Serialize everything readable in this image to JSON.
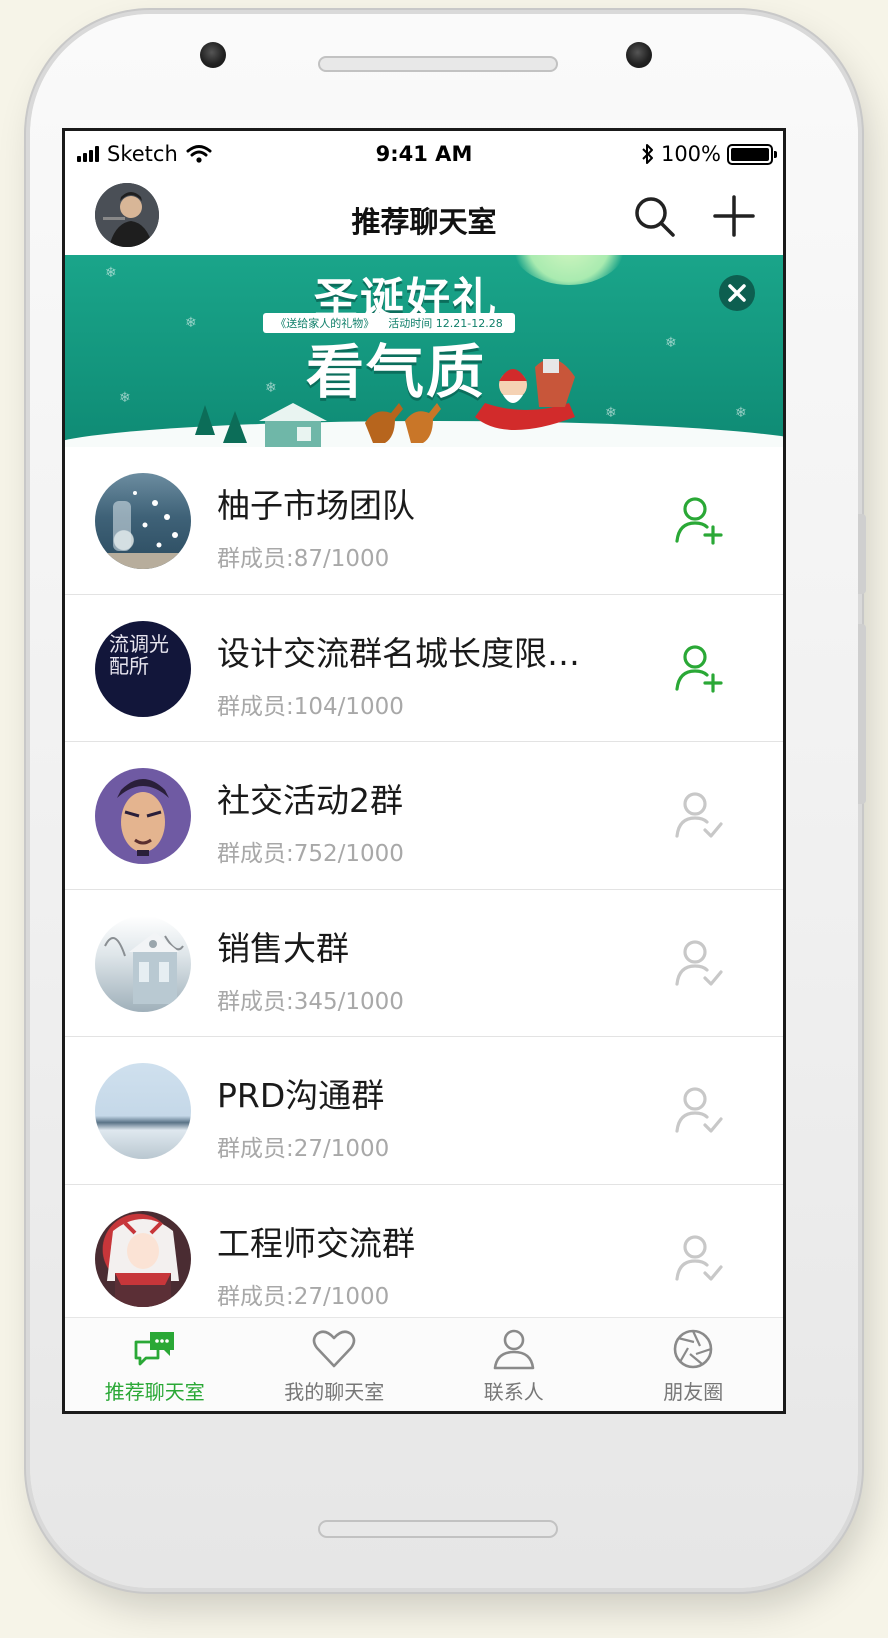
{
  "status_bar": {
    "carrier": "Sketch",
    "time": "9:41 AM",
    "battery": "100%",
    "battery_level": 1.0
  },
  "nav": {
    "title": "推荐聊天室",
    "avatar_icon": "user-avatar",
    "search_icon": "search-icon",
    "add_icon": "plus-icon"
  },
  "banner": {
    "headline": "圣诞好礼",
    "ribbon_left": "《送给家人的礼物》",
    "ribbon_right": "活动时间 12.21-12.28",
    "subline": "看气质",
    "close_icon": "close-icon"
  },
  "rooms": [
    {
      "name": "柚子市场团队",
      "members": "群成员:87/1000",
      "joined": false
    },
    {
      "name": "设计交流群名城长度限…",
      "members": "群成员:104/1000",
      "joined": false,
      "avatar_text": "流调光配所"
    },
    {
      "name": "社交活动2群",
      "members": "群成员:752/1000",
      "joined": true
    },
    {
      "name": "销售大群",
      "members": "群成员:345/1000",
      "joined": true
    },
    {
      "name": "PRD沟通群",
      "members": "群成员:27/1000",
      "joined": true
    },
    {
      "name": "工程师交流群",
      "members": "群成员:27/1000",
      "joined": true
    }
  ],
  "tabs": [
    {
      "label": "推荐聊天室",
      "icon": "chat-bubbles-icon",
      "active": true
    },
    {
      "label": "我的聊天室",
      "icon": "heart-icon",
      "active": false
    },
    {
      "label": "联系人",
      "icon": "person-icon",
      "active": false
    },
    {
      "label": "朋友圈",
      "icon": "aperture-icon",
      "active": false
    }
  ],
  "colors": {
    "accent": "#2aa836",
    "banner": "#1aa58a",
    "muted_icon": "#c8c8c8"
  }
}
